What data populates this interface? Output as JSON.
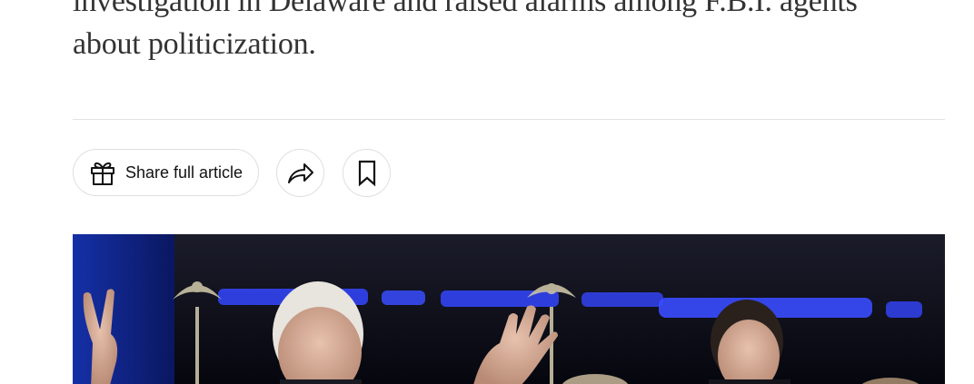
{
  "article": {
    "summary_line1": "investigation in Delaware and raised alarms among F.B.I. agents",
    "summary_line2": "about politicization."
  },
  "actions": {
    "share_full_article_label": "Share full article",
    "share_icon": "share-arrow-icon",
    "gift_icon": "gift-icon",
    "save_icon": "bookmark-icon"
  },
  "photo": {
    "description_icon": "article-photo"
  },
  "colors": {
    "text": "#333333",
    "button_text": "#121212",
    "border": "#dfdfdf",
    "divider": "#e2e2e2"
  }
}
